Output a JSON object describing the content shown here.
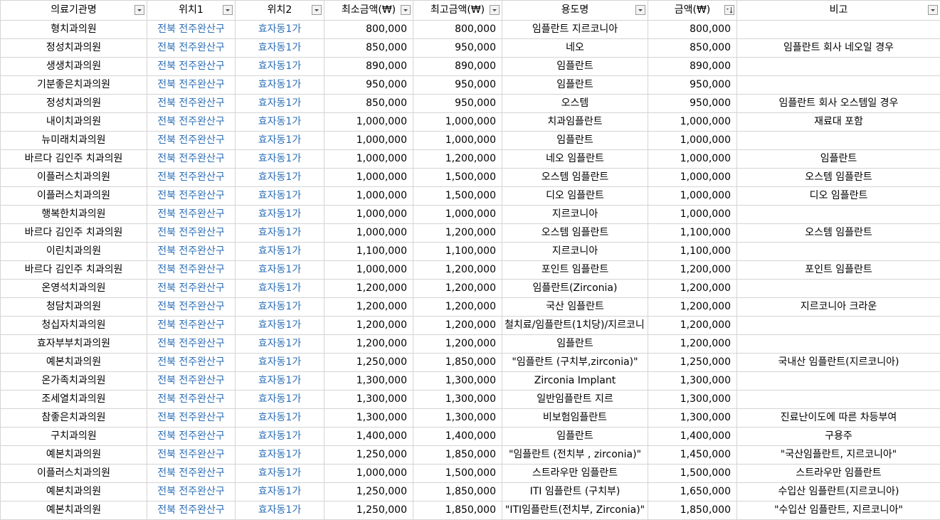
{
  "headers": [
    {
      "label": "의료기관명",
      "filter": "filter-dropdown-icon"
    },
    {
      "label": "위치1",
      "filter": "filter-dropdown-icon"
    },
    {
      "label": "위치2",
      "filter": "filter-dropdown-icon"
    },
    {
      "label": "최소금액(₩)",
      "filter": "filter-dropdown-icon"
    },
    {
      "label": "최고금액(₩)",
      "filter": "filter-dropdown-icon"
    },
    {
      "label": "용도명",
      "filter": "filter-dropdown-icon"
    },
    {
      "label": "금액(₩)",
      "filter": "sort-ascending-filter-icon"
    },
    {
      "label": "비고",
      "filter": "filter-dropdown-icon"
    }
  ],
  "colors": {
    "location_text": "#2e6fb6",
    "grid": "#d4d4d4"
  },
  "rows": [
    [
      "형치과의원",
      "전북 전주완산구",
      "효자동1가",
      "800,000",
      "800,000",
      "임플란트 지르코니아",
      "800,000",
      ""
    ],
    [
      "정성치과의원",
      "전북 전주완산구",
      "효자동1가",
      "850,000",
      "950,000",
      "네오",
      "850,000",
      "임플란트 회사 네오일 경우"
    ],
    [
      "생생치과의원",
      "전북 전주완산구",
      "효자동1가",
      "890,000",
      "890,000",
      "임플란트",
      "890,000",
      ""
    ],
    [
      "기분좋은치과의원",
      "전북 전주완산구",
      "효자동1가",
      "950,000",
      "950,000",
      "임플란트",
      "950,000",
      ""
    ],
    [
      "정성치과의원",
      "전북 전주완산구",
      "효자동1가",
      "850,000",
      "950,000",
      "오스템",
      "950,000",
      "임플란트 회사 오스템일 경우"
    ],
    [
      "내이치과의원",
      "전북 전주완산구",
      "효자동1가",
      "1,000,000",
      "1,000,000",
      "치과임플란트",
      "1,000,000",
      "재료대 포함"
    ],
    [
      "뉴미래치과의원",
      "전북 전주완산구",
      "효자동1가",
      "1,000,000",
      "1,000,000",
      "임플란트",
      "1,000,000",
      ""
    ],
    [
      "바르다 김인주 치과의원",
      "전북 전주완산구",
      "효자동1가",
      "1,000,000",
      "1,200,000",
      "네오 임플란트",
      "1,000,000",
      "임플란트"
    ],
    [
      "이플러스치과의원",
      "전북 전주완산구",
      "효자동1가",
      "1,000,000",
      "1,500,000",
      "오스템 임플란트",
      "1,000,000",
      "오스템 임플란트"
    ],
    [
      "이플러스치과의원",
      "전북 전주완산구",
      "효자동1가",
      "1,000,000",
      "1,500,000",
      "디오 임플란트",
      "1,000,000",
      "디오 임플란트"
    ],
    [
      "행복한치과의원",
      "전북 전주완산구",
      "효자동1가",
      "1,000,000",
      "1,000,000",
      "지르코니아",
      "1,000,000",
      ""
    ],
    [
      "바르다 김인주 치과의원",
      "전북 전주완산구",
      "효자동1가",
      "1,000,000",
      "1,200,000",
      "오스템 임플란트",
      "1,100,000",
      "오스템 임플란트"
    ],
    [
      "이린치과의원",
      "전북 전주완산구",
      "효자동1가",
      "1,100,000",
      "1,100,000",
      "지르코니아",
      "1,100,000",
      ""
    ],
    [
      "바르다 김인주 치과의원",
      "전북 전주완산구",
      "효자동1가",
      "1,000,000",
      "1,200,000",
      "포인트 임플란트",
      "1,200,000",
      "포인트 임플란트"
    ],
    [
      "온영석치과의원",
      "전북 전주완산구",
      "효자동1가",
      "1,200,000",
      "1,200,000",
      "임플란트(Zirconia)",
      "1,200,000",
      ""
    ],
    [
      "청담치과의원",
      "전북 전주완산구",
      "효자동1가",
      "1,200,000",
      "1,200,000",
      "국산 임플란트",
      "1,200,000",
      "지르코니아 크라운"
    ],
    [
      "청십자치과의원",
      "전북 전주완산구",
      "효자동1가",
      "1,200,000",
      "1,200,000",
      "철치료/임플란트(1치당)/지르코니",
      "1,200,000",
      ""
    ],
    [
      "효자부부치과의원",
      "전북 전주완산구",
      "효자동1가",
      "1,200,000",
      "1,200,000",
      "임플란트",
      "1,200,000",
      ""
    ],
    [
      "예본치과의원",
      "전북 전주완산구",
      "효자동1가",
      "1,250,000",
      "1,850,000",
      "\"임플란트 (구치부,zirconia)\"",
      "1,250,000",
      "국내산 임플란트(지르코니아)"
    ],
    [
      "온가족치과의원",
      "전북 전주완산구",
      "효자동1가",
      "1,300,000",
      "1,300,000",
      "Zirconia Implant",
      "1,300,000",
      ""
    ],
    [
      "조세열치과의원",
      "전북 전주완산구",
      "효자동1가",
      "1,300,000",
      "1,300,000",
      "일반임플란트 지르",
      "1,300,000",
      ""
    ],
    [
      "참좋은치과의원",
      "전북 전주완산구",
      "효자동1가",
      "1,300,000",
      "1,300,000",
      "비보험임플란트",
      "1,300,000",
      "진료난이도에 따른 차등부여"
    ],
    [
      "구치과의원",
      "전북 전주완산구",
      "효자동1가",
      "1,400,000",
      "1,400,000",
      "임플란트",
      "1,400,000",
      "구용주"
    ],
    [
      "예본치과의원",
      "전북 전주완산구",
      "효자동1가",
      "1,250,000",
      "1,850,000",
      "\"임플란트 (전치부 , zirconia)\"",
      "1,450,000",
      "\"국산임플란트, 지르코니아\""
    ],
    [
      "이플러스치과의원",
      "전북 전주완산구",
      "효자동1가",
      "1,000,000",
      "1,500,000",
      "스트라우만 임플란트",
      "1,500,000",
      "스트라우만 임플란트"
    ],
    [
      "예본치과의원",
      "전북 전주완산구",
      "효자동1가",
      "1,250,000",
      "1,850,000",
      "ITI 임플란트 (구치부)",
      "1,650,000",
      "수입산 임플란트(지르코니아)"
    ],
    [
      "예본치과의원",
      "전북 전주완산구",
      "효자동1가",
      "1,250,000",
      "1,850,000",
      "\"ITI임플란트(전치부, Zirconia)\"",
      "1,850,000",
      "\"수입산 임플란트, 지르코니아\""
    ]
  ]
}
